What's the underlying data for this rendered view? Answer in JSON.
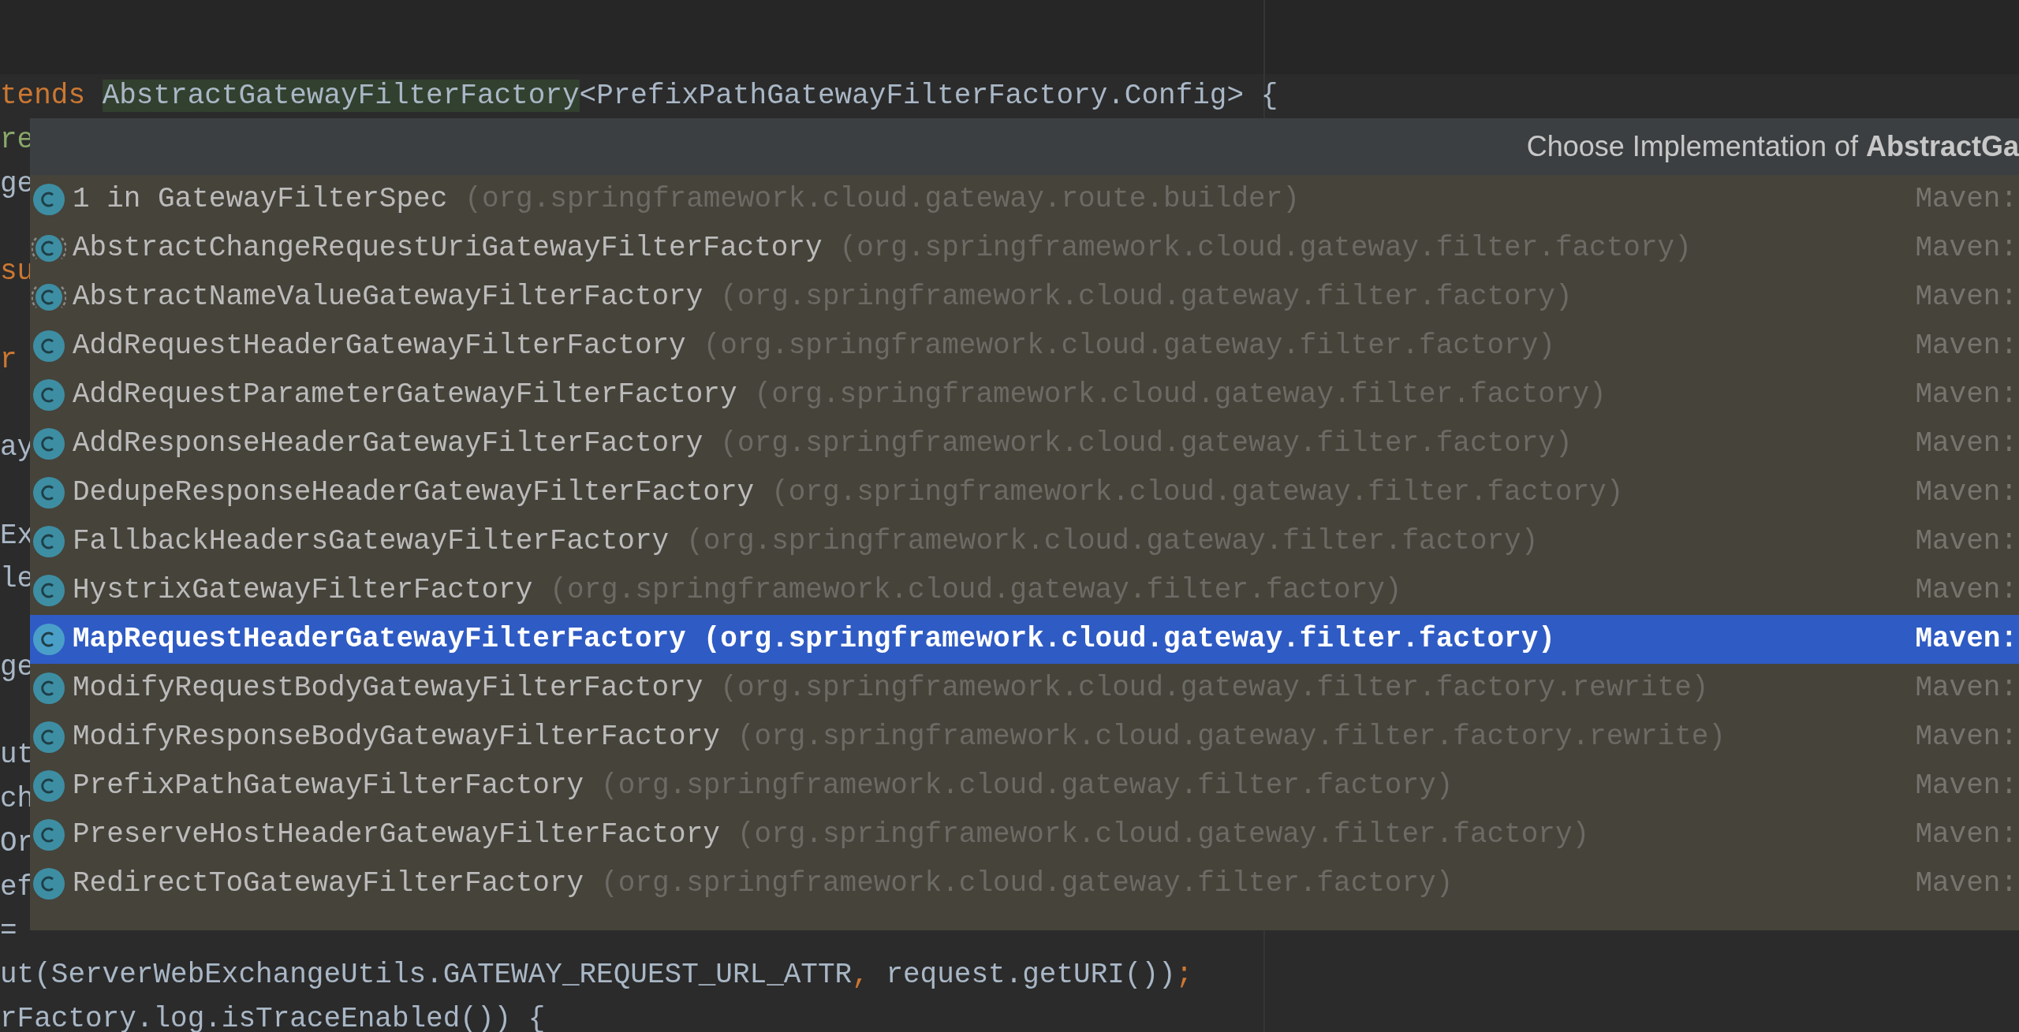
{
  "editor": {
    "lines": [
      {
        "kind": "code",
        "segments": [
          {
            "text": "tends ",
            "kind": "keyword"
          },
          {
            "text": "AbstractGatewayFilterFactory",
            "kind": "highlight"
          },
          {
            "text": "<PrefixPathGatewayFilterFactory.Config> {",
            "kind": "plain"
          }
        ]
      },
      {
        "kind": "code",
        "segments": [
          {
            "text": "re",
            "kind": "green"
          }
        ]
      },
      {
        "kind": "code",
        "segments": [
          {
            "text": "ge",
            "kind": "plain"
          }
        ]
      },
      {
        "kind": "blank"
      },
      {
        "kind": "code",
        "segments": [
          {
            "text": "su",
            "kind": "keyword"
          }
        ]
      },
      {
        "kind": "blank"
      },
      {
        "kind": "code",
        "segments": [
          {
            "text": "r",
            "kind": "keyword"
          }
        ]
      },
      {
        "kind": "blank"
      },
      {
        "kind": "code",
        "segments": [
          {
            "text": "ay",
            "kind": "plain"
          }
        ]
      },
      {
        "kind": "blank"
      },
      {
        "kind": "code",
        "segments": [
          {
            "text": "Ex",
            "kind": "plain"
          }
        ]
      },
      {
        "kind": "code",
        "segments": [
          {
            "text": "le",
            "kind": "plain"
          }
        ]
      },
      {
        "kind": "blank"
      },
      {
        "kind": "code",
        "segments": [
          {
            "text": "ge",
            "kind": "plain"
          }
        ]
      },
      {
        "kind": "blank"
      },
      {
        "kind": "code",
        "segments": [
          {
            "text": "ut",
            "kind": "plain"
          }
        ]
      },
      {
        "kind": "code",
        "segments": [
          {
            "text": "ch",
            "kind": "plain"
          }
        ]
      },
      {
        "kind": "code",
        "segments": [
          {
            "text": "Or",
            "kind": "plain"
          }
        ]
      },
      {
        "kind": "code",
        "segments": [
          {
            "text": "ef",
            "kind": "plain"
          }
        ]
      },
      {
        "kind": "code",
        "segments": [
          {
            "text": "=",
            "kind": "plain"
          }
        ]
      },
      {
        "kind": "code",
        "segments": [
          {
            "text": "ut(ServerWebExchangeUtils.GATEWAY_REQUEST_URL_ATTR",
            "kind": "plain"
          },
          {
            "text": ",",
            "kind": "keyword"
          },
          {
            "text": " request.getURI())",
            "kind": "plain"
          },
          {
            "text": ";",
            "kind": "keyword"
          }
        ]
      },
      {
        "kind": "code",
        "segments": [
          {
            "text": "rFactory.log.isTraceEnabled()) {",
            "kind": "plain"
          }
        ]
      }
    ]
  },
  "popup": {
    "title": "Choose Implementation of **AbstractGa**",
    "items": [
      {
        "name": "1 in GatewayFilterSpec",
        "package": "(org.springframework.cloud.gateway.route.builder)",
        "source": "Maven:",
        "kind": "class",
        "selected": false
      },
      {
        "name": "AbstractChangeRequestUriGatewayFilterFactory",
        "package": "(org.springframework.cloud.gateway.filter.factory)",
        "source": "Maven:",
        "kind": "abstract",
        "selected": false
      },
      {
        "name": "AbstractNameValueGatewayFilterFactory",
        "package": "(org.springframework.cloud.gateway.filter.factory)",
        "source": "Maven:",
        "kind": "abstract",
        "selected": false
      },
      {
        "name": "AddRequestHeaderGatewayFilterFactory",
        "package": "(org.springframework.cloud.gateway.filter.factory)",
        "source": "Maven:",
        "kind": "class",
        "selected": false
      },
      {
        "name": "AddRequestParameterGatewayFilterFactory",
        "package": "(org.springframework.cloud.gateway.filter.factory)",
        "source": "Maven:",
        "kind": "class",
        "selected": false
      },
      {
        "name": "AddResponseHeaderGatewayFilterFactory",
        "package": "(org.springframework.cloud.gateway.filter.factory)",
        "source": "Maven:",
        "kind": "class",
        "selected": false
      },
      {
        "name": "DedupeResponseHeaderGatewayFilterFactory",
        "package": "(org.springframework.cloud.gateway.filter.factory)",
        "source": "Maven:",
        "kind": "class",
        "selected": false
      },
      {
        "name": "FallbackHeadersGatewayFilterFactory",
        "package": "(org.springframework.cloud.gateway.filter.factory)",
        "source": "Maven:",
        "kind": "class",
        "selected": false
      },
      {
        "name": "HystrixGatewayFilterFactory",
        "package": "(org.springframework.cloud.gateway.filter.factory)",
        "source": "Maven:",
        "kind": "class",
        "selected": false
      },
      {
        "name": "MapRequestHeaderGatewayFilterFactory",
        "package": "(org.springframework.cloud.gateway.filter.factory)",
        "source": "Maven:",
        "kind": "class",
        "selected": true
      },
      {
        "name": "ModifyRequestBodyGatewayFilterFactory",
        "package": "(org.springframework.cloud.gateway.filter.factory.rewrite)",
        "source": "Maven:",
        "kind": "class",
        "selected": false
      },
      {
        "name": "ModifyResponseBodyGatewayFilterFactory",
        "package": "(org.springframework.cloud.gateway.filter.factory.rewrite)",
        "source": "Maven:",
        "kind": "class",
        "selected": false
      },
      {
        "name": "PrefixPathGatewayFilterFactory",
        "package": "(org.springframework.cloud.gateway.filter.factory)",
        "source": "Maven:",
        "kind": "class",
        "selected": false
      },
      {
        "name": "PreserveHostHeaderGatewayFilterFactory",
        "package": "(org.springframework.cloud.gateway.filter.factory)",
        "source": "Maven:",
        "kind": "class",
        "selected": false
      },
      {
        "name": "RedirectToGatewayFilterFactory",
        "package": "(org.springframework.cloud.gateway.filter.factory)",
        "source": "Maven:",
        "kind": "class",
        "selected": false
      }
    ]
  }
}
